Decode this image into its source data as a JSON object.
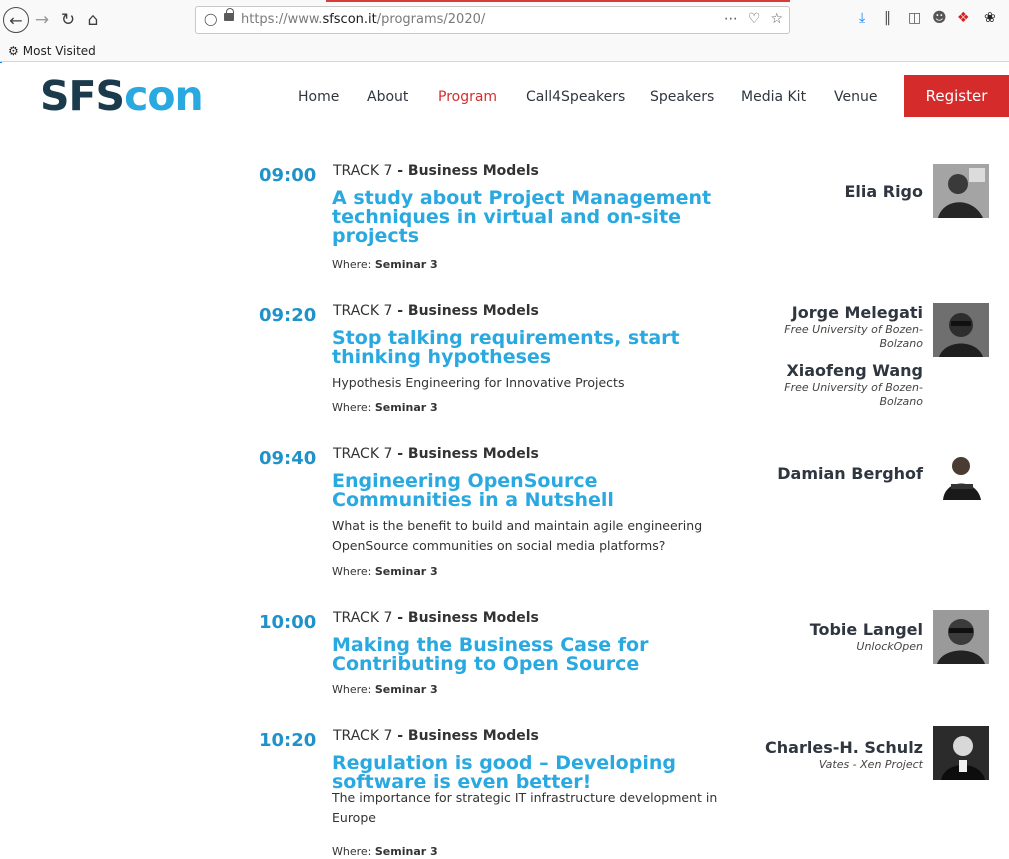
{
  "browser": {
    "url_prefix": "https://www.",
    "url_domain": "sfscon.it",
    "url_path": "/programs/2020/",
    "bookmark_label": "Most Visited"
  },
  "site": {
    "logo_part1": "SFS",
    "logo_part2": "con",
    "nav": [
      "Home",
      "About",
      "Program",
      "Call4Speakers",
      "Speakers",
      "Media Kit",
      "Venue"
    ],
    "register": "Register"
  },
  "sessions": [
    {
      "time": "09:00",
      "track_prefix": "TRACK 7",
      "track_name": " - Business Models",
      "title": "A study about Project Management techniques in virtual and on-site projects",
      "subtitle": "",
      "where_label": "Where:",
      "where_room": "Seminar 3",
      "speakers": [
        {
          "name": "Elia Rigo",
          "affiliation": ""
        }
      ]
    },
    {
      "time": "09:20",
      "track_prefix": "TRACK 7",
      "track_name": " - Business Models",
      "title": "Stop talking requirements, start thinking hypotheses",
      "subtitle": "Hypothesis Engineering for Innovative Projects",
      "where_label": "Where:",
      "where_room": "Seminar 3",
      "speakers": [
        {
          "name": "Jorge Melegati",
          "affiliation": "Free University of Bozen-Bolzano"
        },
        {
          "name": "Xiaofeng Wang",
          "affiliation": "Free University of Bozen-Bolzano"
        }
      ]
    },
    {
      "time": "09:40",
      "track_prefix": "TRACK 7",
      "track_name": " - Business Models",
      "title": "Engineering OpenSource Communities in a Nutshell",
      "subtitle": "What is the benefit to build and maintain agile engineering OpenSource communities on social media platforms?",
      "where_label": "Where:",
      "where_room": "Seminar 3",
      "speakers": [
        {
          "name": "Damian Berghof",
          "affiliation": ""
        }
      ]
    },
    {
      "time": "10:00",
      "track_prefix": "TRACK 7",
      "track_name": " - Business Models",
      "title": "Making the Business Case for Contributing to Open Source",
      "subtitle": "",
      "where_label": "Where:",
      "where_room": "Seminar 3",
      "speakers": [
        {
          "name": "Tobie Langel",
          "affiliation": "UnlockOpen"
        }
      ]
    },
    {
      "time": "10:20",
      "track_prefix": "TRACK 7",
      "track_name": " - Business Models",
      "title": "Regulation is good – Developing software is even better!",
      "subtitle": "The importance for strategic IT infrastructure development in Europe",
      "where_label": "Where:",
      "where_room": "Seminar 3",
      "speakers": [
        {
          "name": "Charles-H. Schulz",
          "affiliation": "Vates - Xen Project"
        }
      ]
    }
  ]
}
